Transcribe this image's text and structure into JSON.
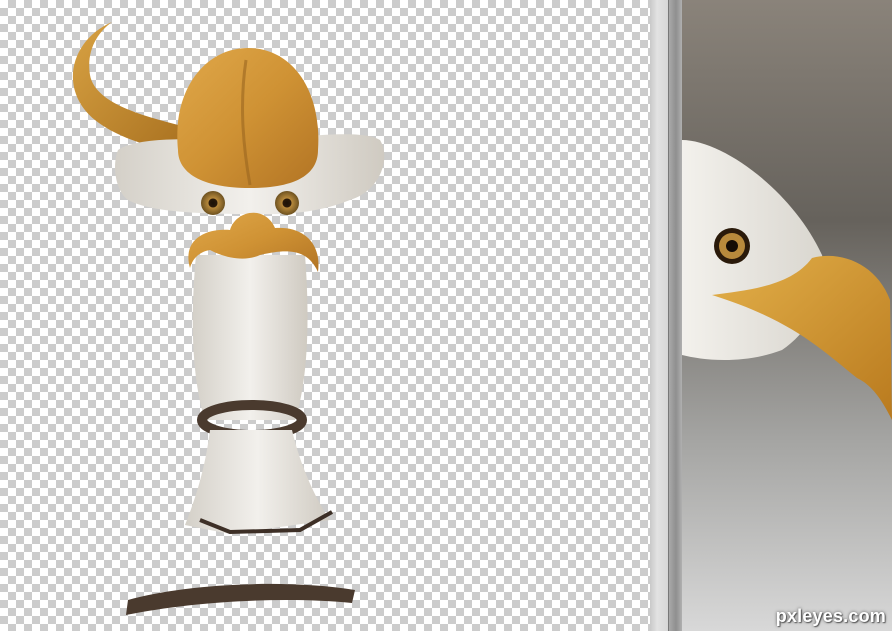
{
  "workspace": {
    "canvas_background": "transparent-checkerboard",
    "left_panel": "eagle-hat-composition",
    "right_panel": "bald-eagle-reference-photo"
  },
  "colors": {
    "beak_orange": "#d49a3a",
    "feather_white": "#e9e6e0",
    "rope_brown": "#4a3a2e",
    "photo_bg": "#6e6a64"
  },
  "watermark": {
    "text": "pxleyes.com"
  }
}
